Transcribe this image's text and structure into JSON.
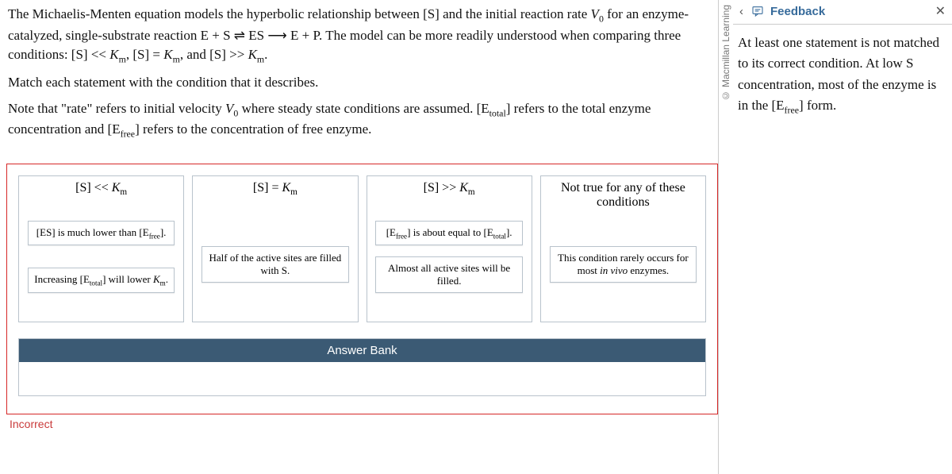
{
  "prompt": {
    "p1_a": "The Michaelis-Menten equation models the hyperbolic relationship between [S] and the initial reaction rate ",
    "p1_v0": "V",
    "p1_v0sub": "0",
    "p1_b": " for an enzyme-catalyzed, single-substrate reaction E + S ⇌ ES ⟶ E + P. The model can be more readily understood when comparing three conditions: [S] << ",
    "km": "K",
    "kmsub": "m",
    "p1_c": ", [S] = ",
    "p1_d": ", and [S] >> ",
    "p1_e": ".",
    "p2": "Match each statement with the condition that it describes.",
    "p3_a": "Note that \"rate\" refers to initial velocity ",
    "p3_b": " where steady state conditions are assumed. [E",
    "etot_sub": "total",
    "p3_c": "] refers to the total enzyme concentration and [E",
    "efree_sub": "free",
    "p3_d": "] refers to the concentration of free enzyme."
  },
  "buckets": {
    "b1": {
      "title_a": "[S] << ",
      "chip1_a": "[ES] is much lower than [E",
      "chip1_b": "].",
      "chip2_a": "Increasing [E",
      "chip2_b": "] will lower ",
      "chip2_c": "."
    },
    "b2": {
      "title_a": "[S] = ",
      "chip1": "Half of the active sites are filled with S."
    },
    "b3": {
      "title_a": "[S] >> ",
      "chip1_a": "[E",
      "chip1_b": "] is about equal to [E",
      "chip1_c": "].",
      "chip2": "Almost all active sites will be filled."
    },
    "b4": {
      "title": "Not true for any of these conditions",
      "chip1_a": "This condition rarely occurs for most ",
      "chip1_b": "in vivo",
      "chip1_c": " enzymes."
    }
  },
  "bank": {
    "header": "Answer Bank"
  },
  "status": {
    "incorrect": "Incorrect"
  },
  "side": {
    "copyright": "© Macmillan Learning",
    "header": "Feedback",
    "body_a": "At least one statement is not matched to its correct condition. At low S concentration, most of the enzyme is in the [E",
    "body_b": "] form."
  }
}
